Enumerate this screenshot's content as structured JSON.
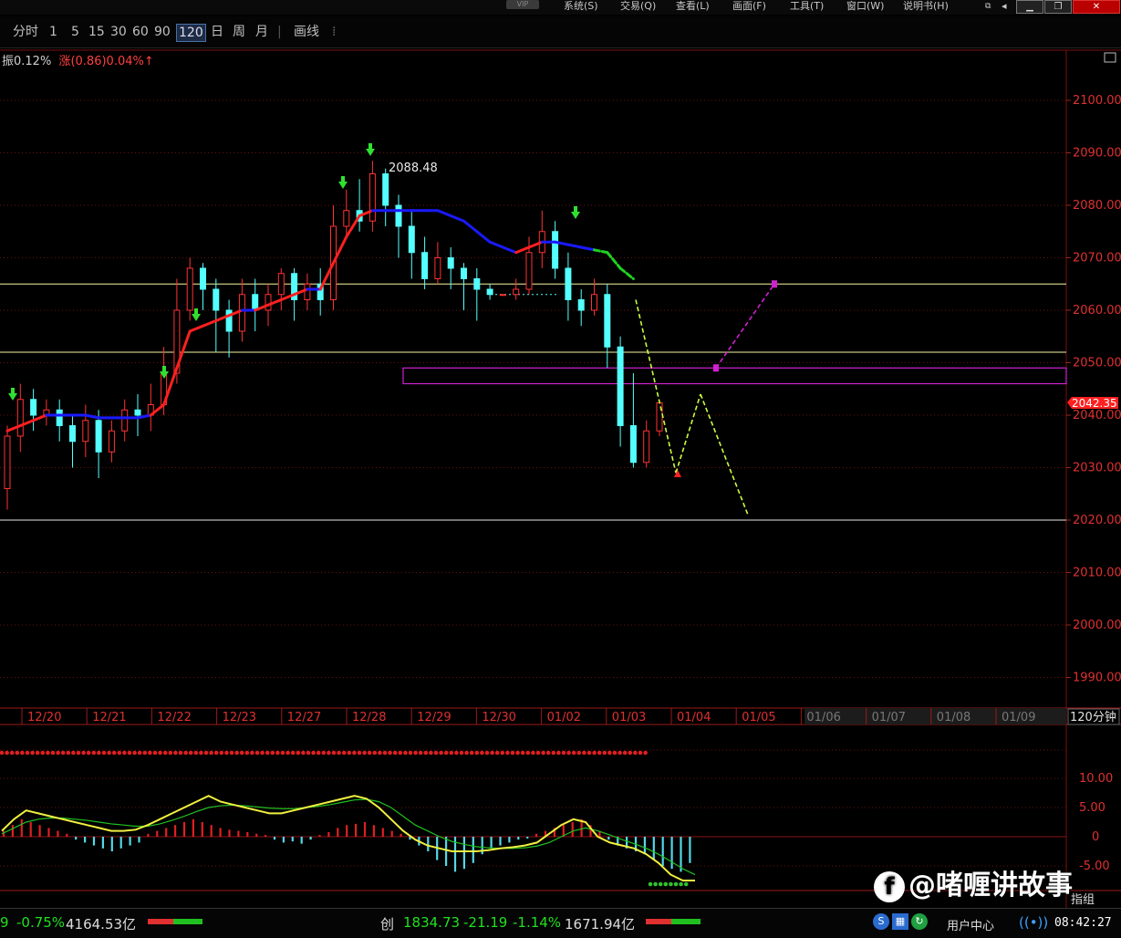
{
  "menubar": {
    "vip": "VIP",
    "items": [
      "系统(S)",
      "交易(Q)",
      "查看(L)",
      "画面(F)",
      "工具(T)",
      "窗口(W)",
      "说明书(H)"
    ]
  },
  "toolbar": {
    "periods": [
      "分时",
      "1",
      "5",
      "15",
      "30",
      "60",
      "90",
      "120",
      "日",
      "周",
      "月"
    ],
    "active_period": "120",
    "draw_tool": "画线"
  },
  "info": {
    "amplitude": "振0.12%",
    "change_label": "涨(0.86)",
    "change_pct": "0.04%↑"
  },
  "price_axis_labels": [
    "2100.00",
    "2090.00",
    "2080.00",
    "2070.00",
    "2060.00",
    "2050.00",
    "2040.00",
    "2030.00",
    "2020.00",
    "2010.00",
    "2000.00",
    "1990.00"
  ],
  "current_price": "2042.35",
  "high_label": "2088.48",
  "date_labels": [
    "12/20",
    "12/21",
    "12/22",
    "12/23",
    "12/27",
    "12/28",
    "12/29",
    "12/30",
    "01/02",
    "01/03",
    "01/04",
    "01/05",
    "01/06",
    "01/07",
    "01/08",
    "01/09"
  ],
  "period_label": "120分钟",
  "indicator_axis_labels": [
    "10.00",
    "5.00",
    "0",
    "-5.00"
  ],
  "indicator_name": "指组",
  "status": {
    "left_index_pct": "-0.75%",
    "left_index_amount": "4164.53亿",
    "chuang_label": "创",
    "chuang_value": "1834.73",
    "chuang_change": "-21.19",
    "chuang_pct": "-1.14%",
    "chuang_amount": "1671.94亿",
    "user_center": "用户中心",
    "time": "08:42:27"
  },
  "watermark": {
    "text": "@啫喱讲故事"
  },
  "colors": {
    "up": "#ff3232",
    "down": "#54ffff",
    "ma_blue": "#1a1aff",
    "ma_red": "#ff2020",
    "support": "#f5f5a0",
    "zone": "#d020d0",
    "projection": "#c8ff40"
  },
  "chart_data": {
    "type": "candlestick",
    "ylim": [
      1985,
      2105
    ],
    "candles": [
      [
        2026,
        2036,
        2022,
        2038
      ],
      [
        2036,
        2043,
        2033,
        2046
      ],
      [
        2043,
        2040,
        2037,
        2045
      ],
      [
        2040,
        2041,
        2038,
        2043
      ],
      [
        2041,
        2038,
        2035,
        2043
      ],
      [
        2038,
        2035,
        2030,
        2040
      ],
      [
        2035,
        2039,
        2032,
        2042
      ],
      [
        2039,
        2033,
        2028,
        2041
      ],
      [
        2033,
        2037,
        2031,
        2039
      ],
      [
        2037,
        2041,
        2035,
        2043
      ],
      [
        2041,
        2040,
        2036,
        2044
      ],
      [
        2040,
        2042,
        2037,
        2046
      ],
      [
        2042,
        2048,
        2040,
        2053
      ],
      [
        2048,
        2060,
        2046,
        2066
      ],
      [
        2060,
        2068,
        2058,
        2070
      ],
      [
        2068,
        2064,
        2060,
        2069
      ],
      [
        2064,
        2060,
        2052,
        2066
      ],
      [
        2060,
        2056,
        2051,
        2062
      ],
      [
        2056,
        2063,
        2054,
        2066
      ],
      [
        2063,
        2060,
        2056,
        2066
      ],
      [
        2060,
        2063,
        2057,
        2065
      ],
      [
        2063,
        2067,
        2060,
        2068
      ],
      [
        2067,
        2062,
        2058,
        2068
      ],
      [
        2062,
        2065,
        2060,
        2067
      ],
      [
        2065,
        2062,
        2059,
        2068
      ],
      [
        2062,
        2076,
        2060,
        2080
      ],
      [
        2076,
        2079,
        2074,
        2083
      ],
      [
        2079,
        2077,
        2075,
        2085
      ],
      [
        2077,
        2086,
        2075,
        2088.48
      ],
      [
        2086,
        2080,
        2076,
        2087
      ],
      [
        2080,
        2076,
        2070,
        2082
      ],
      [
        2076,
        2071,
        2066,
        2079
      ],
      [
        2071,
        2066,
        2064,
        2074
      ],
      [
        2066,
        2070,
        2065,
        2073
      ],
      [
        2070,
        2068,
        2064,
        2072
      ],
      [
        2068,
        2066,
        2060,
        2069
      ],
      [
        2066,
        2064,
        2058,
        2068
      ],
      [
        2064,
        2063,
        2062,
        2065
      ],
      [
        2063,
        2063,
        2063,
        2063
      ],
      [
        2063,
        2064,
        2062,
        2066
      ],
      [
        2064,
        2071,
        2063,
        2074
      ],
      [
        2071,
        2075,
        2068,
        2079
      ],
      [
        2075,
        2068,
        2066,
        2077
      ],
      [
        2068,
        2062,
        2058,
        2071
      ],
      [
        2062,
        2060,
        2057,
        2064
      ],
      [
        2060,
        2063,
        2059,
        2066
      ],
      [
        2063,
        2053,
        2049,
        2065
      ],
      [
        2053,
        2038,
        2034,
        2055
      ],
      [
        2038,
        2031,
        2030,
        2048
      ],
      [
        2031,
        2037,
        2030,
        2039
      ],
      [
        2037,
        2042.35,
        2036,
        2043
      ]
    ],
    "ma_blue": [
      2037,
      2038,
      2039,
      2040,
      2040,
      2040,
      2040,
      2039.5,
      2039.5,
      2039.5,
      2039.5,
      2040,
      2042,
      2049,
      2056,
      2057,
      2058,
      2059,
      2060,
      2060,
      2061,
      2062,
      2063,
      2064,
      2064,
      2069,
      2074,
      2078,
      2079,
      2079,
      2079,
      2079,
      2079,
      2079,
      2078,
      2077,
      2075,
      2073,
      2072,
      2071,
      2072,
      2073,
      2073,
      2072.5,
      2072,
      2071.5,
      2071,
      2068,
      2066
    ],
    "support_levels": [
      2065,
      2052
    ],
    "resistance_zone": [
      2046,
      2049
    ],
    "lower_line": 2020,
    "projection_down": [
      [
        2062,
        2029
      ],
      [
        2029,
        2044
      ],
      [
        2044,
        2021
      ]
    ],
    "projection_up": [
      [
        2049,
        2065
      ]
    ],
    "indicator": {
      "ylim": [
        -10,
        13
      ],
      "macd_bars": [
        1,
        2,
        3,
        2.5,
        2,
        1.5,
        1,
        0.5,
        -0.5,
        -1,
        -1.5,
        -2,
        -2.5,
        -2,
        -1.5,
        -1,
        0.5,
        1,
        1.5,
        2,
        2.5,
        3,
        2.5,
        2,
        1.5,
        1.2,
        1,
        0.8,
        0.5,
        0.3,
        -0.5,
        -1,
        -0.8,
        -1.2,
        -0.5,
        0.3,
        0.8,
        1.5,
        2,
        2.2,
        2.5,
        2,
        1.5,
        1,
        0.5,
        -0.5,
        -1.5,
        -2.5,
        -4,
        -5,
        -6,
        -5.5,
        -4.5,
        -3,
        -2,
        -1.5,
        -1,
        -0.5,
        -0.3,
        0.5,
        1,
        1.5,
        2,
        2.5,
        3,
        2,
        1,
        -0.5,
        -1.5,
        -2,
        -2.5,
        -3,
        -4,
        -5,
        -5.5,
        -6,
        -4.5
      ],
      "dif": [
        1,
        3,
        4.5,
        4,
        3.5,
        3,
        2.5,
        2,
        1.5,
        1,
        1,
        1.2,
        2,
        3,
        4,
        5,
        6,
        7,
        6,
        5.5,
        5,
        4.5,
        4,
        4,
        4.5,
        5,
        5.5,
        6,
        6.5,
        7,
        6.5,
        5,
        3,
        1,
        -0.5,
        -1.5,
        -2,
        -2.5,
        -2.5,
        -2.5,
        -2.3,
        -2,
        -1.8,
        -1.5,
        -1,
        0.5,
        2,
        3,
        2.5,
        0,
        -1,
        -1.5,
        -2,
        -3,
        -4.5,
        -6.5,
        -7.5,
        -7.5
      ],
      "dea": [
        0.5,
        1.5,
        2.5,
        3,
        3.2,
        3.2,
        3,
        2.8,
        2.5,
        2.2,
        2,
        1.8,
        1.8,
        2.2,
        2.8,
        3.5,
        4.3,
        5,
        5.3,
        5.4,
        5.3,
        5.1,
        4.9,
        4.8,
        4.8,
        5,
        5.2,
        5.5,
        5.9,
        6.3,
        6.4,
        6,
        5,
        3.5,
        2,
        1,
        0,
        -0.8,
        -1.3,
        -1.7,
        -1.9,
        -2,
        -2,
        -1.9,
        -1.6,
        -1,
        0,
        1,
        1.5,
        1,
        0.3,
        -0.5,
        -1.2,
        -2,
        -3,
        -4.2,
        -5.5,
        -6.5
      ]
    }
  }
}
